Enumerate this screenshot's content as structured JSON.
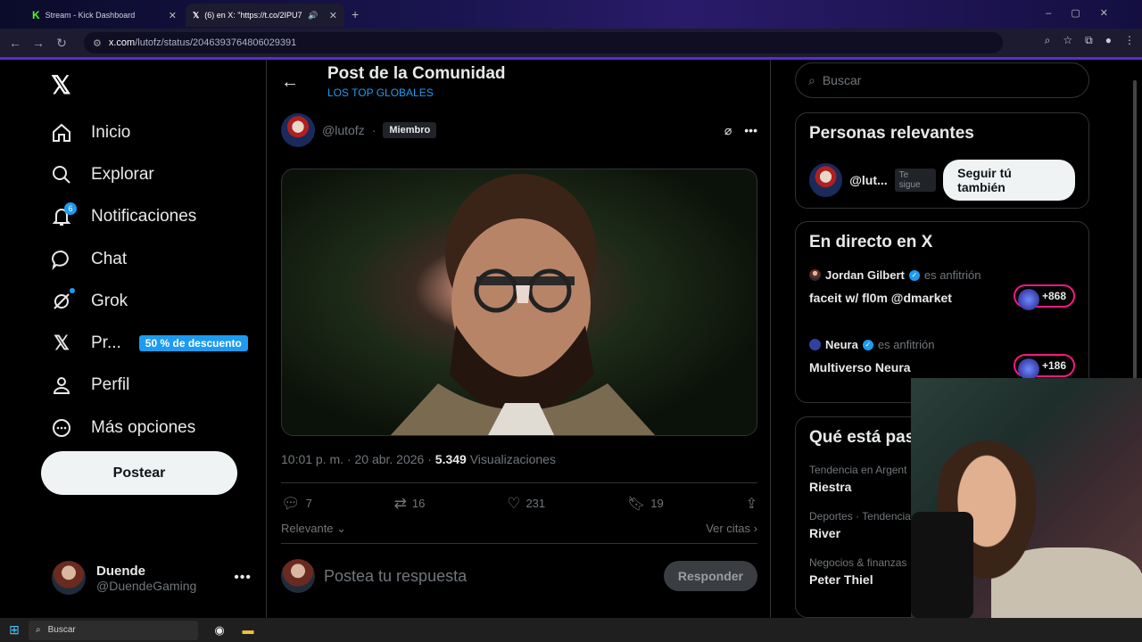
{
  "browser": {
    "tabs": [
      {
        "label": "Stream - Kick Dashboard",
        "icon": "kick-icon",
        "active": false
      },
      {
        "label": "(6) en X: \"https://t.co/2IPU7k",
        "icon": "x-icon",
        "active": true
      }
    ],
    "url_host": "x.com",
    "url_path": "/lutofz/status/2046393764806029391"
  },
  "sidebar": {
    "items": [
      {
        "label": "Inicio",
        "icon": "home-icon"
      },
      {
        "label": "Explorar",
        "icon": "search-icon"
      },
      {
        "label": "Notificaciones",
        "icon": "bell-icon",
        "badge": "6"
      },
      {
        "label": "Chat",
        "icon": "chat-icon"
      },
      {
        "label": "Grok",
        "icon": "grok-icon"
      },
      {
        "label": "Pr...",
        "icon": "x-premium-icon",
        "promo": "50 % de descuento"
      },
      {
        "label": "Perfil",
        "icon": "person-icon"
      },
      {
        "label": "Más opciones",
        "icon": "more-circle-icon"
      }
    ],
    "post_button": "Postear",
    "account": {
      "name": "Duende",
      "handle": "@DuendeGaming"
    }
  },
  "main": {
    "title": "Post de la Comunidad",
    "subtitle": "LOS TOP GLOBALES",
    "author_handle": "@lutofz",
    "separator": "·",
    "member_badge": "Miembro",
    "timestamp": "10:01 p. m. · 20 abr. 2026 ·",
    "views_count": "5.349",
    "views_label": "Visualizaciones",
    "stats": {
      "replies": "7",
      "reposts": "16",
      "likes": "231",
      "bookmarks": "19"
    },
    "sort_label": "Relevante",
    "quotes_label": "Ver citas",
    "reply_placeholder": "Postea tu respuesta",
    "reply_button": "Responder"
  },
  "right": {
    "search_placeholder": "Buscar",
    "relevant_title": "Personas relevantes",
    "relevant_handle": "@lut...",
    "follows_you": "Te sigue",
    "follow_back": "Seguir tú también",
    "live_title": "En directo en X",
    "live": [
      {
        "host": "Jordan Gilbert",
        "role": "es anfitrión",
        "title": "faceit w/ fl0m @dmarket",
        "count": "+868"
      },
      {
        "host": "Neura",
        "role": "es anfitrión",
        "title": "Multiverso Neura",
        "count": "+186"
      }
    ],
    "trends_title": "Qué está pas",
    "trends": [
      {
        "context": "Tendencia en Argent",
        "topic": "Riestra"
      },
      {
        "context": "Deportes · Tendencia",
        "topic": "River"
      },
      {
        "context": "Negocios & finanzas",
        "topic": "Peter Thiel"
      }
    ]
  },
  "taskbar": {
    "search": "Buscar"
  },
  "colors": {
    "accent": "#1d9bf0",
    "live": "#f91880",
    "background": "#000000"
  }
}
